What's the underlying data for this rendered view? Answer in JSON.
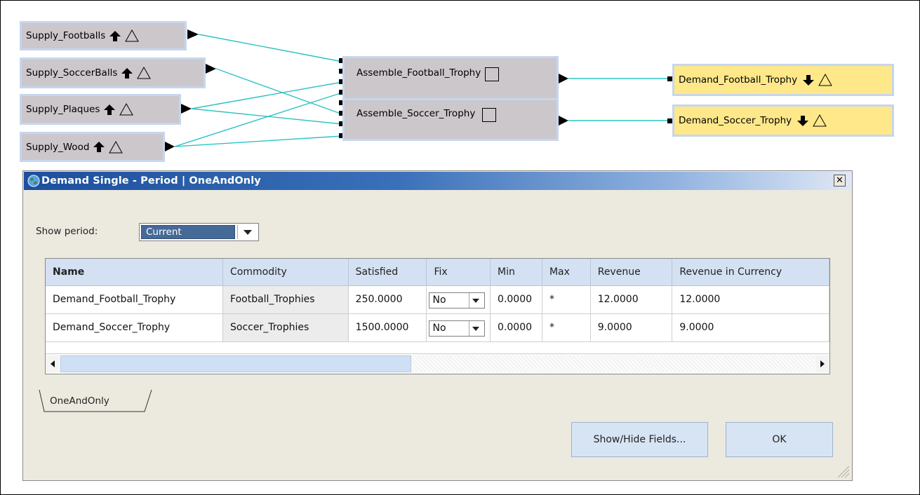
{
  "diagram": {
    "supply_nodes": [
      {
        "label": "Supply_Footballs"
      },
      {
        "label": "Supply_SoccerBalls"
      },
      {
        "label": "Supply_Plaques"
      },
      {
        "label": "Supply_Wood"
      }
    ],
    "process_nodes": [
      {
        "label": "Assemble_Football_Trophy"
      },
      {
        "label": "Assemble_Soccer_Trophy"
      }
    ],
    "demand_nodes": [
      {
        "label": "Demand_Football_Trophy"
      },
      {
        "label": "Demand_Soccer_Trophy"
      }
    ],
    "colors": {
      "node_fill": "#cbc7cb",
      "node_border": "#c6d6ee",
      "demand_fill": "#ffe88a",
      "wire": "#2dc2c4"
    }
  },
  "dialog": {
    "title": "Demand Single - Period | OneAndOnly",
    "close_label": "✕",
    "show_period_label": "Show period:",
    "show_period_value": "Current",
    "columns": [
      "Name",
      "Commodity",
      "Satisfied",
      "Fix",
      "Min",
      "Max",
      "Revenue",
      "Revenue in Currency"
    ],
    "rows": [
      {
        "name": "Demand_Football_Trophy",
        "commodity": "Football_Trophies",
        "satisfied": "250.0000",
        "fix": "No",
        "min": "0.0000",
        "max": "*",
        "revenue": "12.0000",
        "revenue_currency": "12.0000"
      },
      {
        "name": "Demand_Soccer_Trophy",
        "commodity": "Soccer_Trophies",
        "satisfied": "1500.0000",
        "fix": "No",
        "min": "0.0000",
        "max": "*",
        "revenue": "9.0000",
        "revenue_currency": "9.0000"
      }
    ],
    "tab_label": "OneAndOnly",
    "show_hide_label": "Show/Hide Fields...",
    "ok_label": "OK",
    "colors": {
      "titlebar_start": "#1c4f9c",
      "header_bg": "#d3e1f2",
      "button_bg": "#d7e4f3"
    }
  }
}
